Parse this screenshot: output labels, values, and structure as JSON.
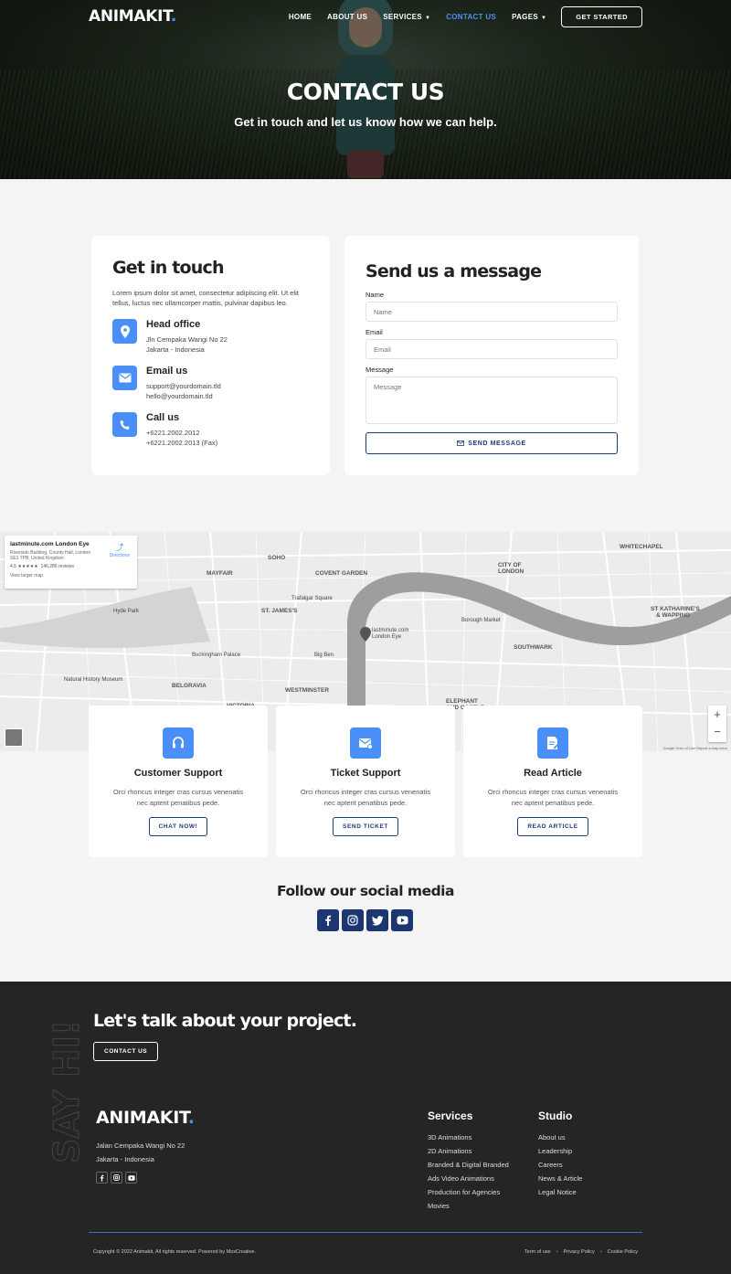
{
  "nav": {
    "logo": "ANIMAKIT",
    "logo_dot": ".",
    "items": [
      "HOME",
      "ABOUT US",
      "SERVICES",
      "CONTACT US",
      "PAGES"
    ],
    "cta": "GET STARTED"
  },
  "hero": {
    "title": "CONTACT US",
    "subtitle": "Get in touch and let us know how we can help."
  },
  "info": {
    "title": "Get in touch",
    "lead": "Lorem ipsum dolor sit amet, consectetur adipiscing elit. Ut elit tellus, luctus nec ullamcorper mattis, pulvinar dapibus leo.",
    "rows": [
      {
        "title": "Head office",
        "line1": "Jln Cempaka Wangi No 22",
        "line2": "Jakarta - Indonesia"
      },
      {
        "title": "Email us",
        "line1": "support@yourdomain.tld",
        "line2": "hello@yourdomain.tld"
      },
      {
        "title": "Call us",
        "line1": "+6221.2002.2012",
        "line2": "+6221.2002.2013 (Fax)"
      }
    ]
  },
  "form": {
    "title": "Send us a message",
    "name_label": "Name",
    "name_placeholder": "Name",
    "email_label": "Email",
    "email_placeholder": "Email",
    "message_label": "Message",
    "message_placeholder": "Message",
    "send": "SEND MESSAGE"
  },
  "map": {
    "place": "lastminute.com London Eye",
    "address": "Riverside Building, County Hall, London SE1 7PB, United Kingdom",
    "rating": "4.5 ★★★★★",
    "reviews": "146,286 reviews",
    "larger": "View larger map",
    "directions": "Directions",
    "labels": [
      "SOHO",
      "MAYFAIR",
      "COVENT GARDEN",
      "ST. JAMES'S",
      "CITY OF LONDON",
      "WHITECHAPEL",
      "Hyde Park",
      "BELGRAVIA",
      "WESTMINSTER",
      "VICTORIA",
      "Borough Market",
      "ST KATHARINE'S & WAPPING",
      "SOUTHWARK",
      "lastminute.com London Eye",
      "Big Ben",
      "Buckingham Palace",
      "Trafalgar Square",
      "Natural History Museum",
      "ELEPHANT AND CASTLE"
    ],
    "credit": "Google   Term of Use   Report a map error"
  },
  "support": [
    {
      "title": "Customer Support",
      "text": "Orci rhoncus integer cras cursus venenatis nec aptent penatibus pede.",
      "btn": "CHAT NOW!"
    },
    {
      "title": "Ticket Support",
      "text": "Orci rhoncus integer cras cursus venenatis nec aptent penatibus pede.",
      "btn": "SEND TICKET"
    },
    {
      "title": "Read Article",
      "text": "Orci rhoncus integer cras cursus venenatis nec aptent penatibus pede.",
      "btn": "READ ARTICLE"
    }
  ],
  "social": {
    "title": "Follow our social media"
  },
  "footer": {
    "sayhi": "SAY HI!",
    "cta_title": "Let's talk about your project.",
    "cta_btn": "CONTACT US",
    "logo": "ANIMAKIT",
    "logo_dot": ".",
    "addr1": "Jalan Cempaka Wangi No 22",
    "addr2": "Jakarta - Indonesia",
    "services_title": "Services",
    "services": [
      "3D Animations",
      "2D Animations",
      "Branded & Digital Branded",
      "Ads Video Animations",
      "Production for Agencies",
      "Movies"
    ],
    "studio_title": "Studio",
    "studio": [
      "About us",
      "Leadership",
      "Careers",
      "News & Article",
      "Legal Notice"
    ],
    "copyright": "Copyright © 2022 Animakit, All rights reserved. Powered by MoxCreative.",
    "links": [
      "Term of use",
      "Privacy Policy",
      "Cookie Policy"
    ],
    "link_sep": "•"
  },
  "colors": {
    "accent": "#4a8ef7",
    "navy": "#1c3672",
    "footer_bg": "#252525"
  }
}
